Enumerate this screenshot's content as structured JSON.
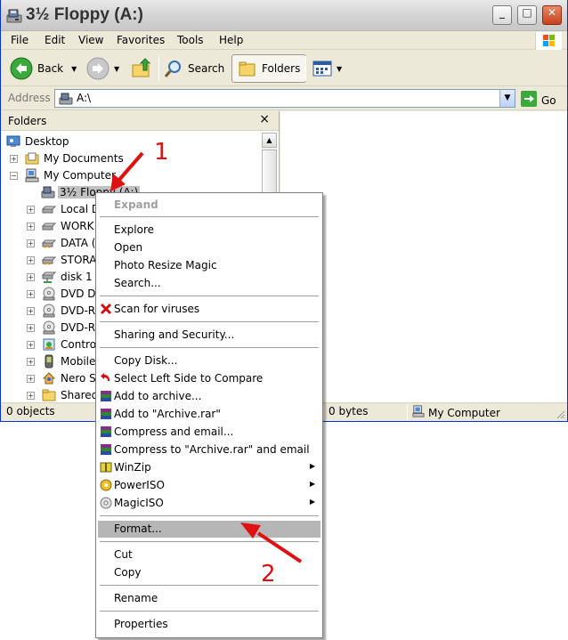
{
  "window": {
    "title": "3½ Floppy (A:)",
    "controls": {
      "minimize": "_",
      "maximize": "□",
      "close": "✕"
    }
  },
  "menubar": [
    "File",
    "Edit",
    "View",
    "Favorites",
    "Tools",
    "Help"
  ],
  "toolbar": {
    "back": "Back",
    "search": "Search",
    "folders": "Folders"
  },
  "address": {
    "label": "Address",
    "value": "A:\\",
    "go": "Go"
  },
  "folders_pane": {
    "title": "Folders",
    "close": "×",
    "tree": [
      {
        "label": "Desktop"
      },
      {
        "label": "My Documents",
        "expander": "+"
      },
      {
        "label": "My Computer",
        "expander": "−"
      },
      {
        "label": "3½ Floppy (A:)"
      },
      {
        "label": "Local D",
        "expander": "+"
      },
      {
        "label": "WORK",
        "expander": "+"
      },
      {
        "label": "DATA (",
        "expander": "+"
      },
      {
        "label": "STORA",
        "expander": "+"
      },
      {
        "label": "disk 1 c",
        "expander": "+"
      },
      {
        "label": "DVD Dr",
        "expander": "+"
      },
      {
        "label": "DVD-RA",
        "expander": "+"
      },
      {
        "label": "DVD-RW",
        "expander": "+"
      },
      {
        "label": "Control",
        "expander": "+"
      },
      {
        "label": "Mobile",
        "expander": "+"
      },
      {
        "label": "Nero Sc",
        "expander": "+"
      },
      {
        "label": "Shared",
        "expander": "+"
      }
    ]
  },
  "statusbar": {
    "objects": "0 objects",
    "size": "0 bytes",
    "location": "My Computer"
  },
  "context_menu": {
    "items": [
      {
        "label": "Expand",
        "disabled": true
      },
      {
        "label": "Explore"
      },
      {
        "label": "Open"
      },
      {
        "label": "Photo Resize Magic"
      },
      {
        "label": "Search..."
      },
      {
        "label": "Scan for viruses"
      },
      {
        "label": "Sharing and Security..."
      },
      {
        "label": "Copy Disk..."
      },
      {
        "label": "Select Left Side to Compare"
      },
      {
        "label": "Add to archive..."
      },
      {
        "label": "Add to \"Archive.rar\""
      },
      {
        "label": "Compress and email..."
      },
      {
        "label": "Compress to \"Archive.rar\" and email"
      },
      {
        "label": "WinZip",
        "submenu": true
      },
      {
        "label": "PowerISO",
        "submenu": true
      },
      {
        "label": "MagicISO",
        "submenu": true
      },
      {
        "label": "Format...",
        "highlighted": true
      },
      {
        "label": "Cut"
      },
      {
        "label": "Copy"
      },
      {
        "label": "Rename"
      },
      {
        "label": "Properties"
      }
    ]
  },
  "annotations": {
    "step1": "1",
    "step2": "2"
  },
  "colors": {
    "accent": "#0831d9",
    "annotation": "#e01010",
    "selection": "#b6b6b6"
  }
}
